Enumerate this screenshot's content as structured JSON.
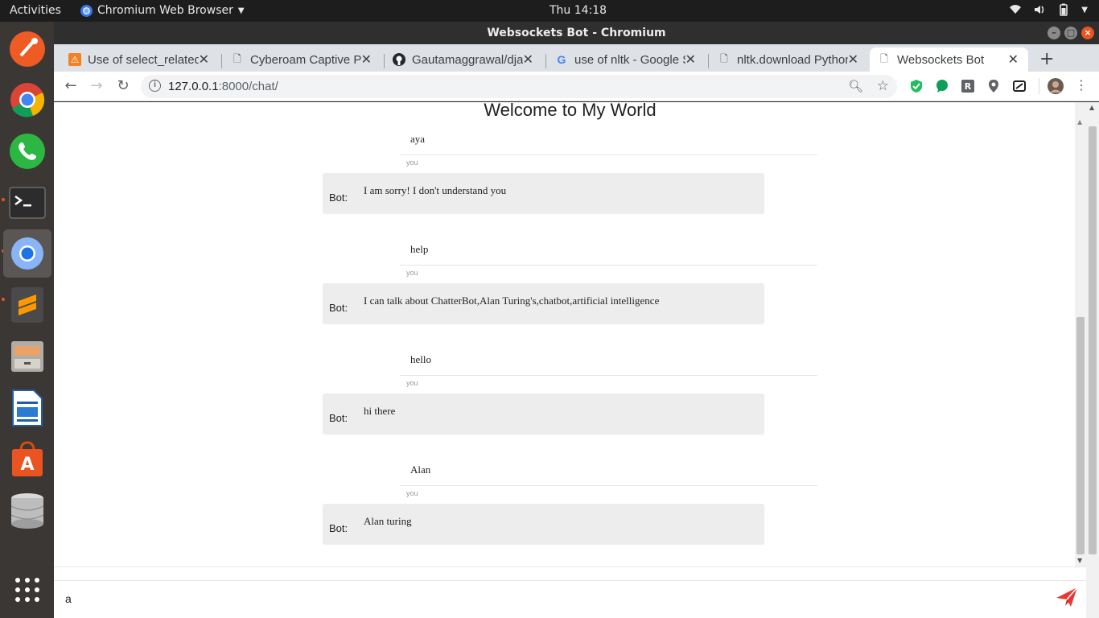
{
  "system_bar": {
    "activities": "Activities",
    "app_name": "Chromium Web Browser",
    "clock": "Thu 14:18"
  },
  "window": {
    "title": "Websockets Bot - Chromium"
  },
  "tabs": [
    {
      "title": "Use of select_related",
      "favicon": "stackoverflow-icon"
    },
    {
      "title": "Cyberoam Captive Portal",
      "favicon": "page-icon"
    },
    {
      "title": "Gautamaggrawal/django",
      "favicon": "github-icon"
    },
    {
      "title": "use of nltk - Google Search",
      "favicon": "google-icon"
    },
    {
      "title": "nltk.download Python",
      "favicon": "page-icon"
    },
    {
      "title": "Websockets Bot",
      "favicon": "page-icon"
    }
  ],
  "address_bar": {
    "host": "127.0.0.1",
    "path": ":8000/chat/"
  },
  "page": {
    "title": "Welcome to My World",
    "bot_label": "Bot:",
    "user_label": "you",
    "messages": [
      {
        "from": "user",
        "text": "aya"
      },
      {
        "from": "bot",
        "text": "I am sorry! I don't understand you"
      },
      {
        "from": "user",
        "text": "help"
      },
      {
        "from": "bot",
        "text": "I can talk about ChatterBot,Alan Turing's,chatbot,artificial intelligence"
      },
      {
        "from": "user",
        "text": "hello"
      },
      {
        "from": "bot",
        "text": "hi there"
      },
      {
        "from": "user",
        "text": "Alan"
      },
      {
        "from": "bot",
        "text": "Alan turing"
      }
    ],
    "input_value": "a"
  },
  "colors": {
    "send_icon": "#e53935",
    "ubuntu_orange": "#e95420",
    "bot_bubble": "#ededed"
  }
}
